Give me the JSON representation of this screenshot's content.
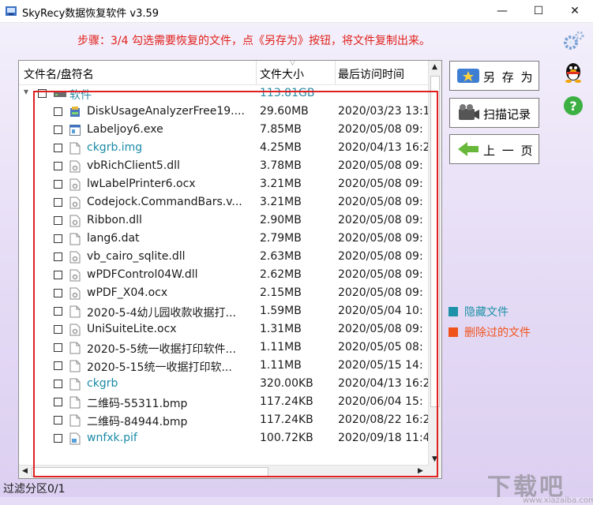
{
  "window": {
    "title": "SkyRecy数据恢复软件 v3.59",
    "minimize_glyph": "—",
    "maximize_glyph": "☐",
    "close_glyph": "✕"
  },
  "step_text": "步骤：3/4 勾选需要恢复的文件，点《另存为》按钮，将文件复制出来。",
  "table": {
    "headers": {
      "name": "文件名/盘符名",
      "size": "文件大小",
      "date": "最后访问时间"
    },
    "folder": {
      "expand": "▾",
      "name": "软件",
      "size": "113.81GB"
    },
    "rows": [
      {
        "name": "DiskUsageAnalyzerFree19....",
        "size": "29.60MB",
        "date": "2020/03/23 13:1",
        "icon": "installer-icon",
        "hidden": false
      },
      {
        "name": "Labeljoy6.exe",
        "size": "7.85MB",
        "date": "2020/05/08 09:",
        "icon": "exe-icon",
        "hidden": false
      },
      {
        "name": "ckgrb.img",
        "size": "4.25MB",
        "date": "2020/04/13 16:2",
        "icon": "file-icon",
        "hidden": true
      },
      {
        "name": "vbRichClient5.dll",
        "size": "3.78MB",
        "date": "2020/05/08 09:",
        "icon": "dll-icon",
        "hidden": false
      },
      {
        "name": "lwLabelPrinter6.ocx",
        "size": "3.21MB",
        "date": "2020/05/08 09:",
        "icon": "dll-icon",
        "hidden": false
      },
      {
        "name": "Codejock.CommandBars.v...",
        "size": "3.21MB",
        "date": "2020/05/08 09:",
        "icon": "dll-icon",
        "hidden": false
      },
      {
        "name": "Ribbon.dll",
        "size": "2.90MB",
        "date": "2020/05/08 09:",
        "icon": "dll-icon",
        "hidden": false
      },
      {
        "name": "lang6.dat",
        "size": "2.79MB",
        "date": "2020/05/08 09:",
        "icon": "file-icon",
        "hidden": false
      },
      {
        "name": "vb_cairo_sqlite.dll",
        "size": "2.63MB",
        "date": "2020/05/08 09:",
        "icon": "dll-icon",
        "hidden": false
      },
      {
        "name": "wPDFControl04W.dll",
        "size": "2.62MB",
        "date": "2020/05/08 09:",
        "icon": "dll-icon",
        "hidden": false
      },
      {
        "name": "wPDF_X04.ocx",
        "size": "2.15MB",
        "date": "2020/05/08 09:",
        "icon": "dll-icon",
        "hidden": false
      },
      {
        "name": "2020-5-4幼儿园收款收据打...",
        "size": "1.59MB",
        "date": "2020/05/04 10:",
        "icon": "file-icon",
        "hidden": false
      },
      {
        "name": "UniSuiteLite.ocx",
        "size": "1.31MB",
        "date": "2020/05/08 09:",
        "icon": "dll-icon",
        "hidden": false
      },
      {
        "name": "2020-5-5统一收据打印软件...",
        "size": "1.11MB",
        "date": "2020/05/05 08:",
        "icon": "file-icon",
        "hidden": false
      },
      {
        "name": "2020-5-15统一收据打印软...",
        "size": "1.11MB",
        "date": "2020/05/15 14:",
        "icon": "file-icon",
        "hidden": false
      },
      {
        "name": "ckgrb",
        "size": "320.00KB",
        "date": "2020/04/13 16:2",
        "icon": "file-icon",
        "hidden": true
      },
      {
        "name": "二维码-55311.bmp",
        "size": "117.24KB",
        "date": "2020/06/04 15:",
        "icon": "file-icon",
        "hidden": false
      },
      {
        "name": "二维码-84944.bmp",
        "size": "117.24KB",
        "date": "2020/08/22 16:2",
        "icon": "file-icon",
        "hidden": false
      },
      {
        "name": "wnfxk.pif",
        "size": "100.72KB",
        "date": "2020/09/18 11:4",
        "icon": "pif-icon",
        "hidden": true
      }
    ]
  },
  "buttons": {
    "save_as": "另 存 为",
    "scan_log": "扫描记录",
    "prev": "上 一 页"
  },
  "legend": {
    "hidden_label": "隐藏文件",
    "hidden_color": "#1d91a8",
    "deleted_label": "删除过的文件",
    "deleted_color": "#f0521c"
  },
  "status": "过滤分区0/1",
  "watermark": {
    "main": "下载吧",
    "sub": "www.xiazaiba.com"
  }
}
